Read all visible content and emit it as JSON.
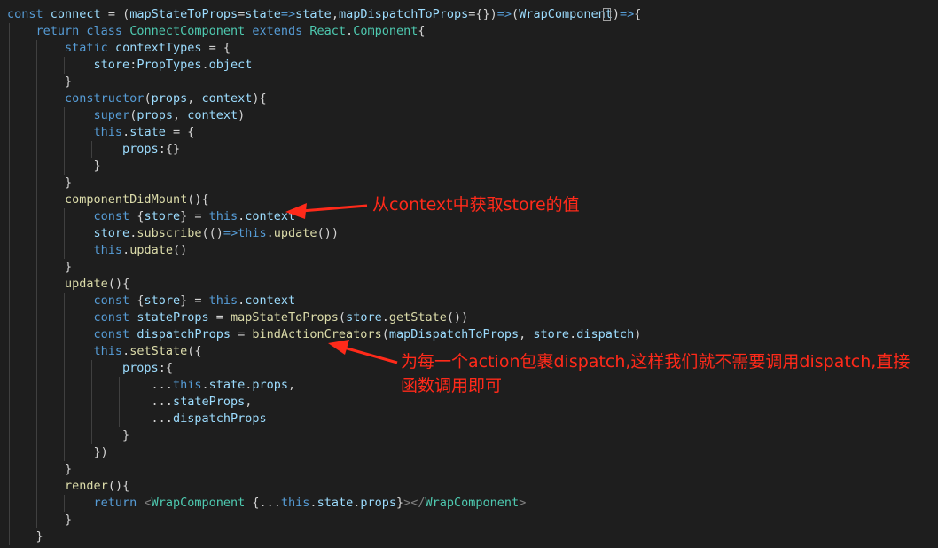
{
  "colors": {
    "background": "#1e1e1e",
    "keyword": "#569cd6",
    "identifier": "#9cdcfe",
    "function": "#dcdcaa",
    "class": "#4ec9b0",
    "plain": "#d4d4d4",
    "tag_bracket": "#808080",
    "annotation": "#ff2a1a"
  },
  "code_lines": [
    [
      {
        "t": "const ",
        "c": "keyword"
      },
      {
        "t": "connect",
        "c": "identifier"
      },
      {
        "t": " = (",
        "c": "plain"
      },
      {
        "t": "mapStateToProps",
        "c": "identifier"
      },
      {
        "t": "=",
        "c": "plain"
      },
      {
        "t": "state",
        "c": "identifier"
      },
      {
        "t": "=>",
        "c": "keyword"
      },
      {
        "t": "state",
        "c": "identifier"
      },
      {
        "t": ",",
        "c": "plain"
      },
      {
        "t": "mapDispatchToProps",
        "c": "identifier"
      },
      {
        "t": "={})",
        "c": "plain"
      },
      {
        "t": "=>",
        "c": "keyword"
      },
      {
        "t": "(",
        "c": "plain"
      },
      {
        "t": "WrapComponent",
        "c": "identifier"
      },
      {
        "t": ")",
        "c": "plain"
      },
      {
        "t": "=>",
        "c": "keyword"
      },
      {
        "t": "{",
        "c": "plain"
      }
    ],
    [
      {
        "t": "    ",
        "c": "plain"
      },
      {
        "t": "return ",
        "c": "keyword"
      },
      {
        "t": "class ",
        "c": "keyword"
      },
      {
        "t": "ConnectComponent ",
        "c": "class"
      },
      {
        "t": "extends ",
        "c": "keyword"
      },
      {
        "t": "React",
        "c": "class"
      },
      {
        "t": ".",
        "c": "plain"
      },
      {
        "t": "Component",
        "c": "class"
      },
      {
        "t": "{",
        "c": "plain"
      }
    ],
    [
      {
        "t": "        ",
        "c": "plain"
      },
      {
        "t": "static ",
        "c": "keyword"
      },
      {
        "t": "contextTypes",
        "c": "identifier"
      },
      {
        "t": " = {",
        "c": "plain"
      }
    ],
    [
      {
        "t": "            ",
        "c": "plain"
      },
      {
        "t": "store",
        "c": "identifier"
      },
      {
        "t": ":",
        "c": "plain"
      },
      {
        "t": "PropTypes",
        "c": "identifier"
      },
      {
        "t": ".",
        "c": "plain"
      },
      {
        "t": "object",
        "c": "identifier"
      }
    ],
    [
      {
        "t": "        }",
        "c": "plain"
      }
    ],
    [
      {
        "t": "        ",
        "c": "plain"
      },
      {
        "t": "constructor",
        "c": "keyword"
      },
      {
        "t": "(",
        "c": "plain"
      },
      {
        "t": "props",
        "c": "identifier"
      },
      {
        "t": ", ",
        "c": "plain"
      },
      {
        "t": "context",
        "c": "identifier"
      },
      {
        "t": "){",
        "c": "plain"
      }
    ],
    [
      {
        "t": "            ",
        "c": "plain"
      },
      {
        "t": "super",
        "c": "keyword"
      },
      {
        "t": "(",
        "c": "plain"
      },
      {
        "t": "props",
        "c": "identifier"
      },
      {
        "t": ", ",
        "c": "plain"
      },
      {
        "t": "context",
        "c": "identifier"
      },
      {
        "t": ")",
        "c": "plain"
      }
    ],
    [
      {
        "t": "            ",
        "c": "plain"
      },
      {
        "t": "this",
        "c": "keyword"
      },
      {
        "t": ".",
        "c": "plain"
      },
      {
        "t": "state",
        "c": "identifier"
      },
      {
        "t": " = {",
        "c": "plain"
      }
    ],
    [
      {
        "t": "                ",
        "c": "plain"
      },
      {
        "t": "props",
        "c": "identifier"
      },
      {
        "t": ":{}",
        "c": "plain"
      }
    ],
    [
      {
        "t": "            }",
        "c": "plain"
      }
    ],
    [
      {
        "t": "        }",
        "c": "plain"
      }
    ],
    [
      {
        "t": "        ",
        "c": "plain"
      },
      {
        "t": "componentDidMount",
        "c": "function"
      },
      {
        "t": "(){",
        "c": "plain"
      }
    ],
    [
      {
        "t": "            ",
        "c": "plain"
      },
      {
        "t": "const ",
        "c": "keyword"
      },
      {
        "t": "{",
        "c": "plain"
      },
      {
        "t": "store",
        "c": "identifier"
      },
      {
        "t": "} = ",
        "c": "plain"
      },
      {
        "t": "this",
        "c": "keyword"
      },
      {
        "t": ".",
        "c": "plain"
      },
      {
        "t": "context",
        "c": "identifier"
      }
    ],
    [
      {
        "t": "            ",
        "c": "plain"
      },
      {
        "t": "store",
        "c": "identifier"
      },
      {
        "t": ".",
        "c": "plain"
      },
      {
        "t": "subscribe",
        "c": "function"
      },
      {
        "t": "(()",
        "c": "plain"
      },
      {
        "t": "=>",
        "c": "keyword"
      },
      {
        "t": "this",
        "c": "keyword"
      },
      {
        "t": ".",
        "c": "plain"
      },
      {
        "t": "update",
        "c": "function"
      },
      {
        "t": "())",
        "c": "plain"
      }
    ],
    [
      {
        "t": "            ",
        "c": "plain"
      },
      {
        "t": "this",
        "c": "keyword"
      },
      {
        "t": ".",
        "c": "plain"
      },
      {
        "t": "update",
        "c": "function"
      },
      {
        "t": "()",
        "c": "plain"
      }
    ],
    [
      {
        "t": "        }",
        "c": "plain"
      }
    ],
    [
      {
        "t": "        ",
        "c": "plain"
      },
      {
        "t": "update",
        "c": "function"
      },
      {
        "t": "(){",
        "c": "plain"
      }
    ],
    [
      {
        "t": "            ",
        "c": "plain"
      },
      {
        "t": "const ",
        "c": "keyword"
      },
      {
        "t": "{",
        "c": "plain"
      },
      {
        "t": "store",
        "c": "identifier"
      },
      {
        "t": "} = ",
        "c": "plain"
      },
      {
        "t": "this",
        "c": "keyword"
      },
      {
        "t": ".",
        "c": "plain"
      },
      {
        "t": "context",
        "c": "identifier"
      }
    ],
    [
      {
        "t": "            ",
        "c": "plain"
      },
      {
        "t": "const ",
        "c": "keyword"
      },
      {
        "t": "stateProps",
        "c": "identifier"
      },
      {
        "t": " = ",
        "c": "plain"
      },
      {
        "t": "mapStateToProps",
        "c": "function"
      },
      {
        "t": "(",
        "c": "plain"
      },
      {
        "t": "store",
        "c": "identifier"
      },
      {
        "t": ".",
        "c": "plain"
      },
      {
        "t": "getState",
        "c": "function"
      },
      {
        "t": "())",
        "c": "plain"
      }
    ],
    [
      {
        "t": "            ",
        "c": "plain"
      },
      {
        "t": "const ",
        "c": "keyword"
      },
      {
        "t": "dispatchProps",
        "c": "identifier"
      },
      {
        "t": " = ",
        "c": "plain"
      },
      {
        "t": "bindActionCreators",
        "c": "function"
      },
      {
        "t": "(",
        "c": "plain"
      },
      {
        "t": "mapDispatchToProps",
        "c": "identifier"
      },
      {
        "t": ", ",
        "c": "plain"
      },
      {
        "t": "store",
        "c": "identifier"
      },
      {
        "t": ".",
        "c": "plain"
      },
      {
        "t": "dispatch",
        "c": "identifier"
      },
      {
        "t": ")",
        "c": "plain"
      }
    ],
    [
      {
        "t": "            ",
        "c": "plain"
      },
      {
        "t": "this",
        "c": "keyword"
      },
      {
        "t": ".",
        "c": "plain"
      },
      {
        "t": "setState",
        "c": "function"
      },
      {
        "t": "({",
        "c": "plain"
      }
    ],
    [
      {
        "t": "                ",
        "c": "plain"
      },
      {
        "t": "props",
        "c": "identifier"
      },
      {
        "t": ":{",
        "c": "plain"
      }
    ],
    [
      {
        "t": "                    ...",
        "c": "plain"
      },
      {
        "t": "this",
        "c": "keyword"
      },
      {
        "t": ".",
        "c": "plain"
      },
      {
        "t": "state",
        "c": "identifier"
      },
      {
        "t": ".",
        "c": "plain"
      },
      {
        "t": "props",
        "c": "identifier"
      },
      {
        "t": ",",
        "c": "plain"
      }
    ],
    [
      {
        "t": "                    ...",
        "c": "plain"
      },
      {
        "t": "stateProps",
        "c": "identifier"
      },
      {
        "t": ",",
        "c": "plain"
      }
    ],
    [
      {
        "t": "                    ...",
        "c": "plain"
      },
      {
        "t": "dispatchProps",
        "c": "identifier"
      }
    ],
    [
      {
        "t": "                }",
        "c": "plain"
      }
    ],
    [
      {
        "t": "            })",
        "c": "plain"
      }
    ],
    [
      {
        "t": "        }",
        "c": "plain"
      }
    ],
    [
      {
        "t": "        ",
        "c": "plain"
      },
      {
        "t": "render",
        "c": "function"
      },
      {
        "t": "(){",
        "c": "plain"
      }
    ],
    [
      {
        "t": "            ",
        "c": "plain"
      },
      {
        "t": "return ",
        "c": "keyword"
      },
      {
        "t": "<",
        "c": "tag_bracket"
      },
      {
        "t": "WrapComponent ",
        "c": "class"
      },
      {
        "t": "{...",
        "c": "plain"
      },
      {
        "t": "this",
        "c": "keyword"
      },
      {
        "t": ".",
        "c": "plain"
      },
      {
        "t": "state",
        "c": "identifier"
      },
      {
        "t": ".",
        "c": "plain"
      },
      {
        "t": "props",
        "c": "identifier"
      },
      {
        "t": "}",
        "c": "plain"
      },
      {
        "t": "></",
        "c": "tag_bracket"
      },
      {
        "t": "WrapComponent",
        "c": "class"
      },
      {
        "t": ">",
        "c": "tag_bracket"
      }
    ],
    [
      {
        "t": "        }",
        "c": "plain"
      }
    ],
    [
      {
        "t": "    }",
        "c": "plain"
      }
    ]
  ],
  "annotations": {
    "context": "从context中获取store的值",
    "dispatch_line1": "为每一个action包裹dispatch,这样我们就不需要调用dispatch,直接",
    "dispatch_line2": "函数调用即可"
  }
}
